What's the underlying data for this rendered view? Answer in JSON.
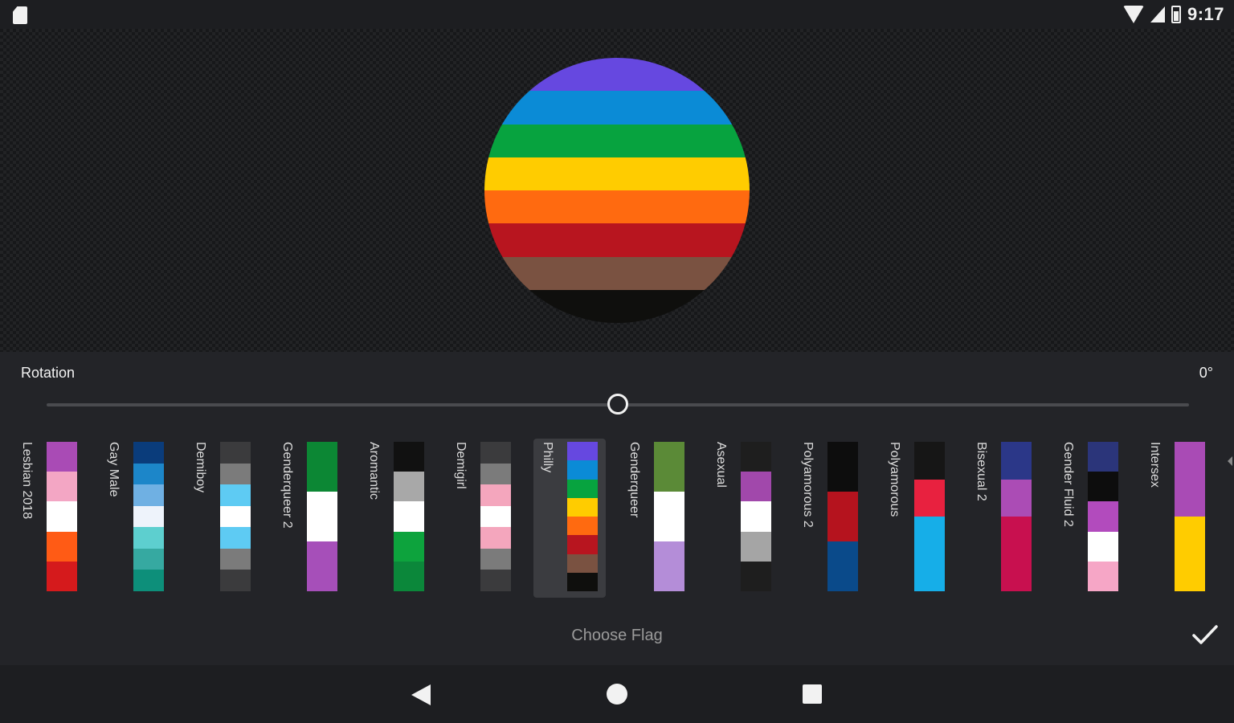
{
  "status_bar": {
    "time": "9:17"
  },
  "preview": {
    "stripes": [
      "#6648e0",
      "#0b8bd6",
      "#07a33f",
      "#ffcc00",
      "#ff6a10",
      "#b8151f",
      "#7a5241",
      "#0f0f0d"
    ]
  },
  "rotation": {
    "label": "Rotation",
    "value": "0°",
    "level": 0.5
  },
  "flags": [
    {
      "name": "Lesbian 2018",
      "colors": [
        "#a94bb5",
        "#f3a6c4",
        "#ffffff",
        "#ff5b15",
        "#d51a1c"
      ]
    },
    {
      "name": "Gay Male",
      "colors": [
        "#0a3c7b",
        "#1c86c9",
        "#6fb0e3",
        "#eef3fb",
        "#5dcfcf",
        "#36a9a1",
        "#0d8f7a"
      ]
    },
    {
      "name": "Demiboy",
      "colors": [
        "#3b3b3d",
        "#7b7b7b",
        "#5ecbf3",
        "#ffffff",
        "#5ecbf3",
        "#7b7b7b",
        "#3b3b3d"
      ]
    },
    {
      "name": "Genderqueer 2",
      "colors": [
        "#0c8734",
        "#ffffff",
        "#a64fb9"
      ]
    },
    {
      "name": "Aromantic",
      "colors": [
        "#111111",
        "#a8a8a8",
        "#ffffff",
        "#0da33d",
        "#0b873a"
      ]
    },
    {
      "name": "Demigirl",
      "colors": [
        "#3b3b3d",
        "#7b7b7b",
        "#f4a6bd",
        "#ffffff",
        "#f4a6bd",
        "#7b7b7b",
        "#3b3b3d"
      ]
    },
    {
      "name": "Philly",
      "colors": [
        "#6648e0",
        "#0b8bd6",
        "#07a33f",
        "#ffcc00",
        "#ff6a10",
        "#b8151f",
        "#7a5241",
        "#0f0f0d"
      ]
    },
    {
      "name": "Genderqueer",
      "colors": [
        "#5b8a37",
        "#ffffff",
        "#b48dd8"
      ]
    },
    {
      "name": "Asexual",
      "colors": [
        "#1e1e1e",
        "#a148ab",
        "#ffffff",
        "#a5a5a5",
        "#1e1e1e"
      ]
    },
    {
      "name": "Polyamorous 2",
      "colors": [
        "#0d0d0d",
        "#b5131e",
        "#0a4a8a"
      ]
    },
    {
      "name": "Polyamorous",
      "colors": [
        "#161616",
        "#e8213f",
        "#16aee8",
        "#16aee8"
      ]
    },
    {
      "name": "Bisexual 2",
      "colors": [
        "#2b3788",
        "#ab4cb5",
        "#c8104f",
        "#c8104f"
      ]
    },
    {
      "name": "Gender Fluid 2",
      "colors": [
        "#2b357a",
        "#0d0d0d",
        "#b24bbd",
        "#ffffff",
        "#f6a6c6"
      ]
    },
    {
      "name": "Intersex",
      "colors": [
        "#a94bb5",
        "#ffcc00"
      ]
    }
  ],
  "selected_flag": "Philly",
  "footer": {
    "choose_flag": "Choose Flag"
  }
}
